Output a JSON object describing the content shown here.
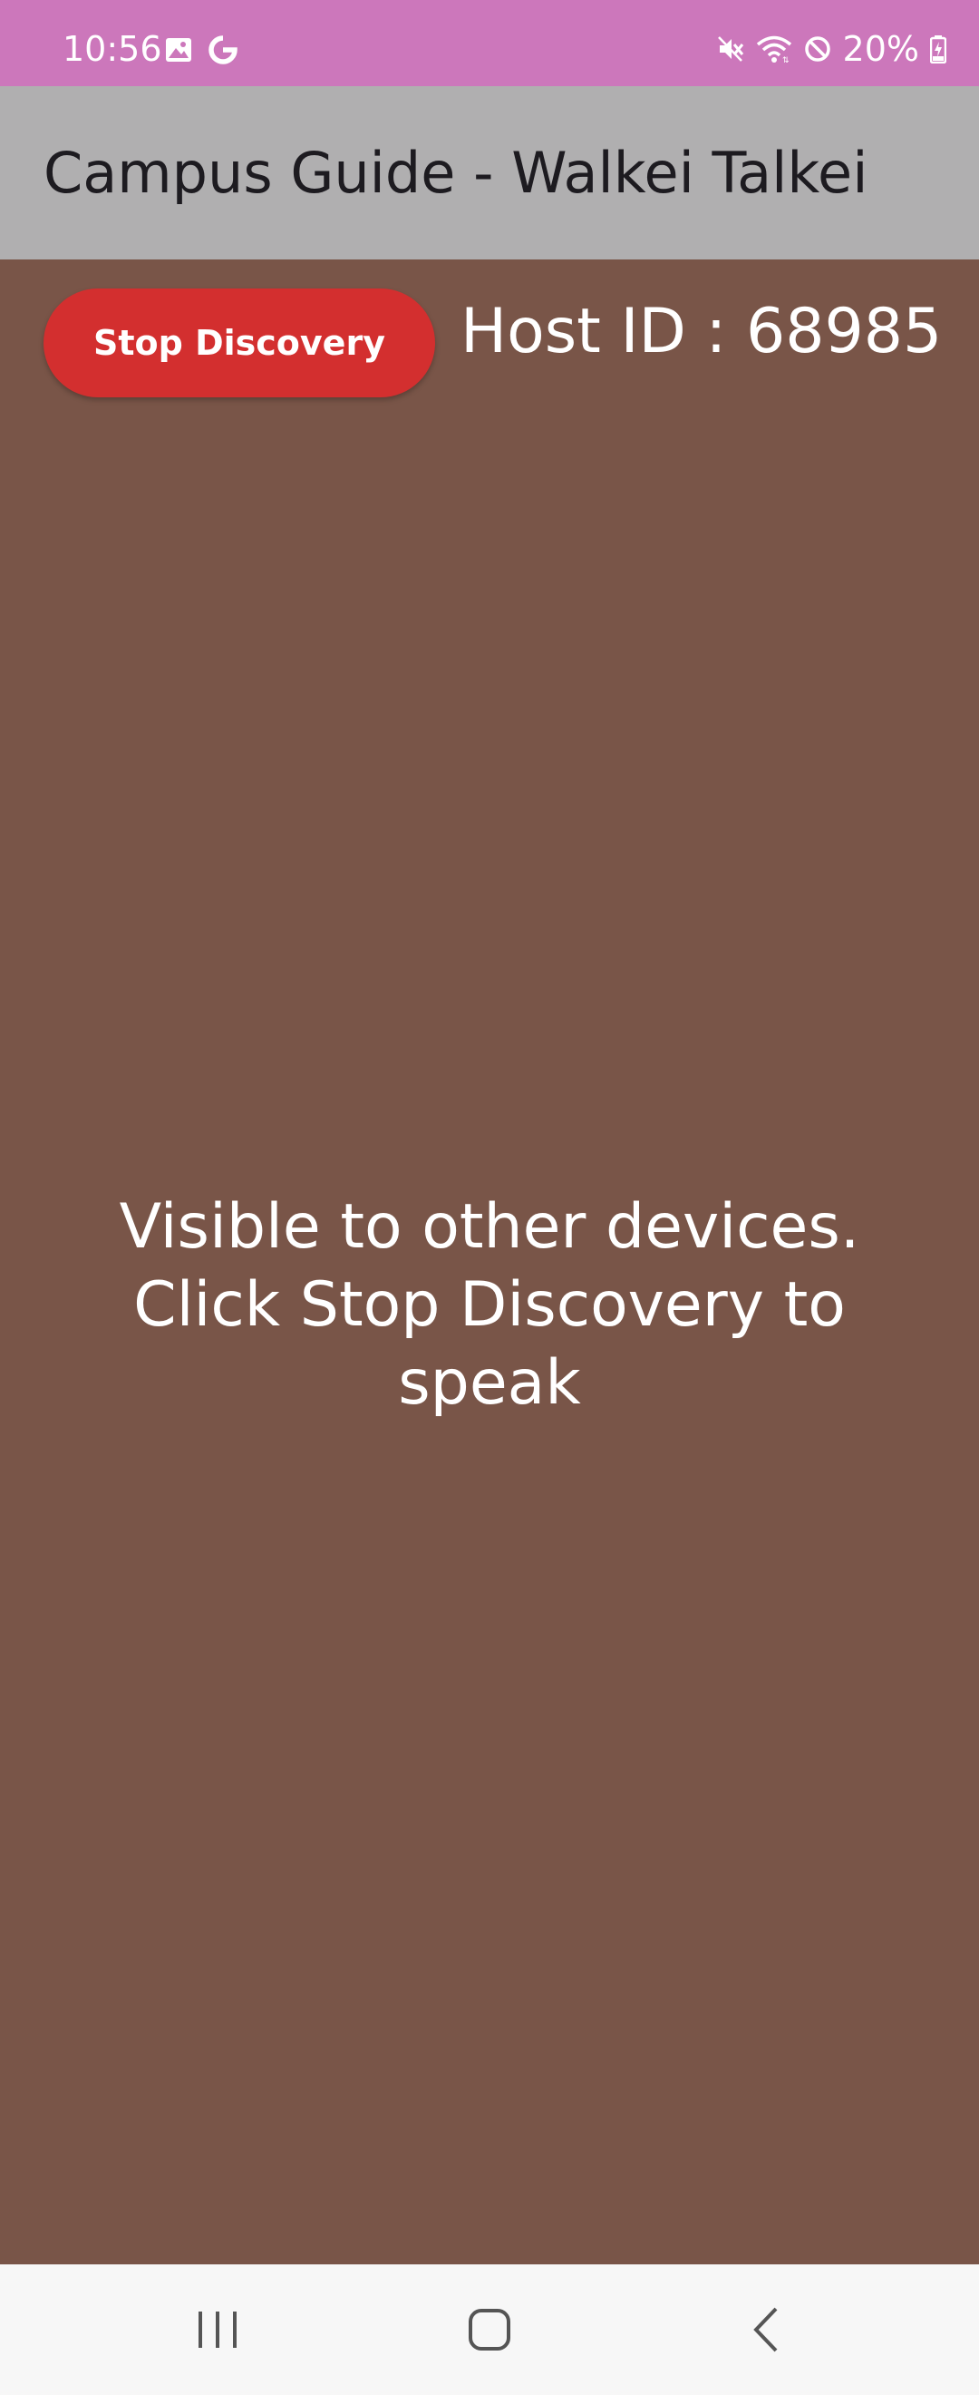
{
  "status_bar": {
    "time": "10:56",
    "battery": "20%",
    "left_icons": [
      "image-icon",
      "google-icon"
    ],
    "right_icons": [
      "mute-icon",
      "wifi-icon",
      "do-not-disturb-icon",
      "battery-charging-icon"
    ],
    "background": "#CC77BB"
  },
  "app_bar": {
    "title": "Campus Guide - Walkei Talkei",
    "background": "#B0AFB0"
  },
  "main": {
    "stop_button_label": "Stop Discovery",
    "host_id": "Host ID : 68985",
    "message": "Visible to other devices. Click Stop Discovery to speak",
    "background": "#795548",
    "button_color": "#D32F2F"
  },
  "nav_bar": {
    "items": [
      "recent-apps-icon",
      "home-icon",
      "back-icon"
    ]
  }
}
